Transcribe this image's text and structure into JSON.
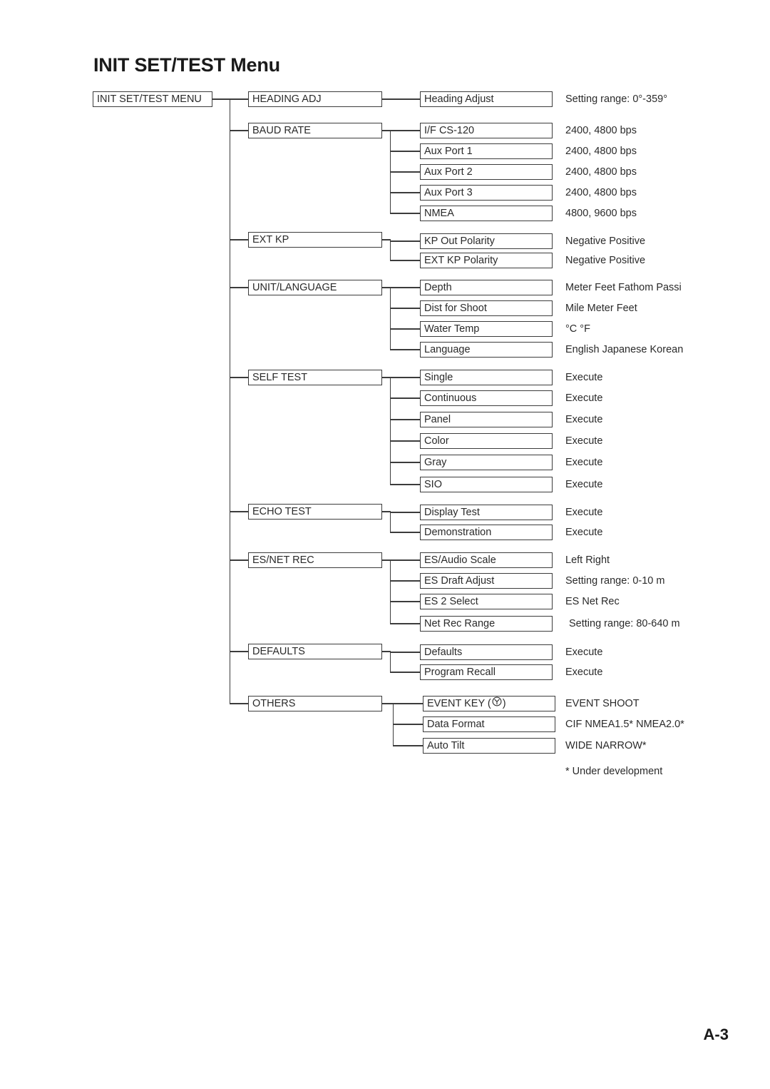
{
  "page": {
    "title": "INIT SET/TEST Menu",
    "page_number": "A-3",
    "footnote": "* Under development"
  },
  "root": {
    "label": "INIT SET/TEST MENU"
  },
  "menu": [
    {
      "label": "HEADING ADJ",
      "children": [
        {
          "label": "Heading Adjust",
          "note": "Setting range: 0°-359°"
        }
      ]
    },
    {
      "label": "BAUD RATE",
      "children": [
        {
          "label": "I/F CS-120",
          "note": "2400, 4800 bps"
        },
        {
          "label": "Aux Port 1",
          "note": "2400, 4800 bps"
        },
        {
          "label": "Aux Port 2",
          "note": "2400, 4800 bps"
        },
        {
          "label": "Aux Port 3",
          "note": "2400, 4800 bps"
        },
        {
          "label": "NMEA",
          "note": "4800, 9600 bps"
        }
      ]
    },
    {
      "label": "EXT KP",
      "children": [
        {
          "label": "KP Out Polarity",
          "note": "Negative   Positive"
        },
        {
          "label": "EXT KP Polarity",
          "note": "Negative   Positive"
        }
      ]
    },
    {
      "label": "UNIT/LANGUAGE",
      "children": [
        {
          "label": "Depth",
          "note": "Meter Feet Fathom Passi"
        },
        {
          "label": "Dist for Shoot",
          "note": "Mile  Meter  Feet"
        },
        {
          "label": "Water Temp",
          "note": "°C     °F"
        },
        {
          "label": "Language",
          "note": "English Japanese Korean"
        }
      ]
    },
    {
      "label": "SELF TEST",
      "children": [
        {
          "label": "Single",
          "note": "Execute"
        },
        {
          "label": "Continuous",
          "note": "Execute"
        },
        {
          "label": "Panel",
          "note": "Execute"
        },
        {
          "label": "Color",
          "note": "Execute"
        },
        {
          "label": "Gray",
          "note": "Execute"
        },
        {
          "label": "SIO",
          "note": "Execute"
        }
      ]
    },
    {
      "label": "ECHO TEST",
      "children": [
        {
          "label": "Display Test",
          "note": "Execute"
        },
        {
          "label": "Demonstration",
          "note": "Execute"
        }
      ]
    },
    {
      "label": "ES/NET REC",
      "children": [
        {
          "label": "ES/Audio Scale",
          "note": "Left  Right"
        },
        {
          "label": "ES Draft Adjust",
          "note": "Setting range: 0-10 m"
        },
        {
          "label": "ES 2 Select",
          "note": "ES  Net Rec"
        },
        {
          "label": "Net Rec Range",
          "note": "Setting range: 80-640 m"
        }
      ]
    },
    {
      "label": "DEFAULTS",
      "children": [
        {
          "label": "Defaults",
          "note": "Execute"
        },
        {
          "label": "Program Recall",
          "note": "Execute"
        }
      ]
    },
    {
      "label": "OTHERS",
      "children": [
        {
          "label": "EVENT KEY (",
          "label_suffix": ")",
          "icon": "event-mark-icon",
          "note": "EVENT   SHOOT"
        },
        {
          "label": "Data Format",
          "note": "CIF NMEA1.5* NMEA2.0*"
        },
        {
          "label": "Auto Tilt",
          "note": "WIDE   NARROW*"
        }
      ]
    }
  ],
  "colors": {
    "line": "#3c3c3c",
    "text": "#2a2a2a",
    "title": "#1a1a1a"
  }
}
